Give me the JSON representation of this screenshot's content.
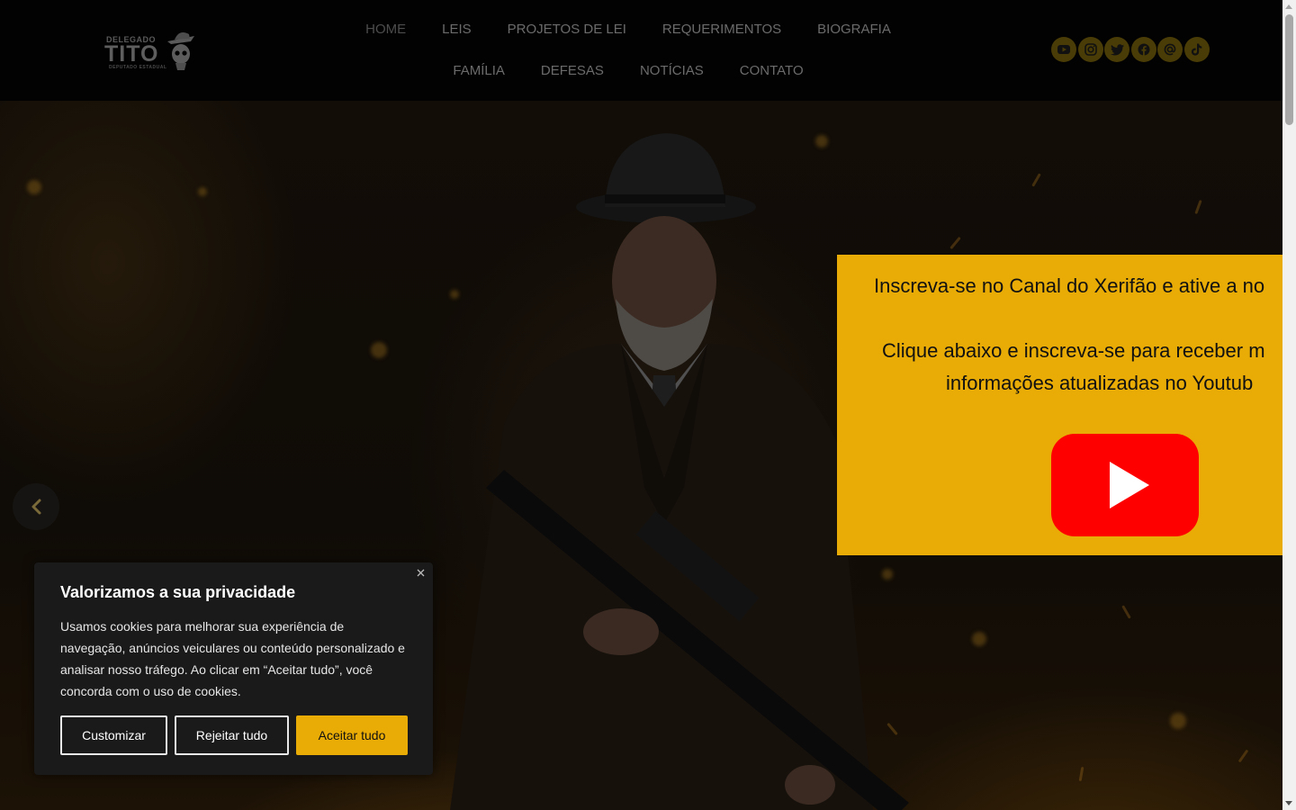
{
  "logo": {
    "line1": "DELEGADO",
    "line2": "TITO",
    "line3": "DEPUTADO ESTADUAL"
  },
  "nav": {
    "items": [
      {
        "label": "HOME",
        "active": true
      },
      {
        "label": "LEIS"
      },
      {
        "label": "PROJETOS DE LEI"
      },
      {
        "label": "REQUERIMENTOS"
      },
      {
        "label": "BIOGRAFIA"
      },
      {
        "label": "FAMÍLIA"
      },
      {
        "label": "DEFESAS"
      },
      {
        "label": "NOTÍCIAS"
      },
      {
        "label": "CONTATO"
      }
    ]
  },
  "social": {
    "icons": [
      "youtube-icon",
      "instagram-icon",
      "twitter-icon",
      "facebook-icon",
      "threads-icon",
      "tiktok-icon"
    ],
    "color": "#4a3c06"
  },
  "promo": {
    "line1": "Inscreva-se no Canal do Xerifão e ative a no",
    "line2": "Clique abaixo e inscreva-se para receber m",
    "line3": "informações atualizadas no Youtub",
    "background": "#e9ac06",
    "youtube_red": "#ff0000"
  },
  "cookie": {
    "title": "Valorizamos a sua privacidade",
    "text": "Usamos cookies para melhorar sua experiência de navegação, anúncios veiculares ou conteúdo personalizado e analisar nosso tráfego. Ao clicar em “Aceitar tudo”, você concorda com o uso de cookies.",
    "customize_label": "Customizar",
    "reject_label": "Rejeitar tudo",
    "accept_label": "Aceitar tudo",
    "accent": "#e9ac06"
  }
}
